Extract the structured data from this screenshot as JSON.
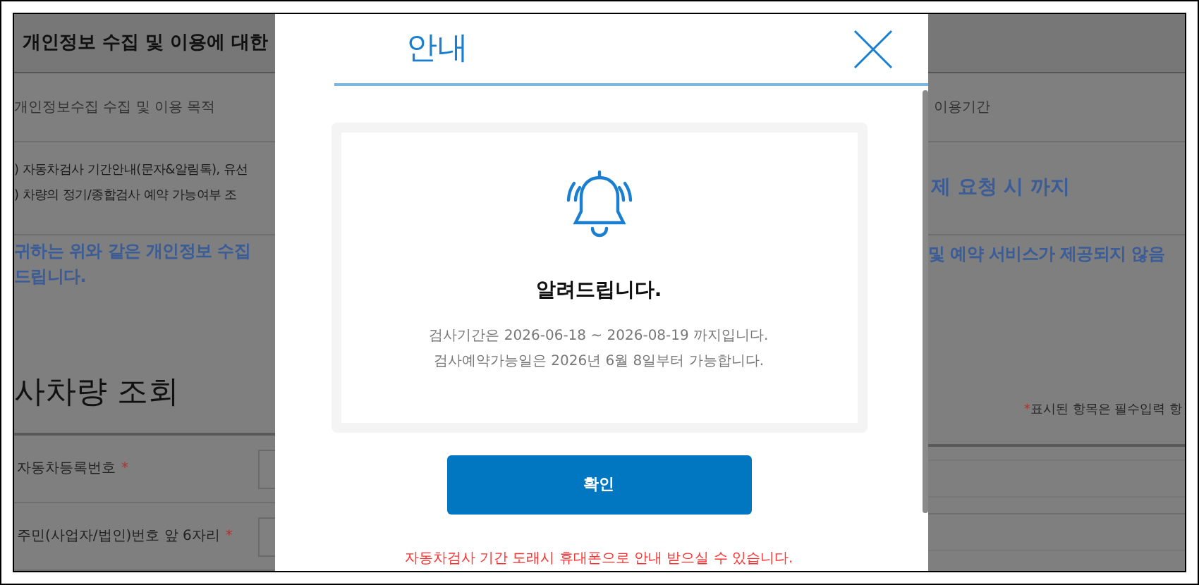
{
  "background_page": {
    "section_title": "개인정보 수집 및 이용에 대한",
    "purpose_header": "개인정보수집 수집 및 이용 목적",
    "purpose_items": [
      ") 자동차검사 기간안내(문자&알림톡), 유선",
      ") 차량의 정기/종합검사 예약 가능여부 조"
    ],
    "notice_lines": [
      "귀하는 위와 같은 개인정보 수집",
      "드립니다."
    ],
    "search_title": "사차량 조회",
    "required_mark": "*",
    "form_fields": [
      {
        "label": "자동차등록번호",
        "required": true
      },
      {
        "label": "주민(사업자/법인)번호 앞 6자리",
        "required": true
      }
    ],
    "period_header": "이용기간",
    "period_value": "제 요청 시 까지",
    "notice_right": "및 예약 서비스가 제공되지 않음",
    "required_note": "표시된 항목은 필수입력 항"
  },
  "dialog": {
    "title": "안내",
    "heading": "알려드립니다.",
    "message_lines": [
      "검사기간은 2026-06-18 ~ 2026-08-19 까지입니다.",
      "검사예약가능일은 2026년 6월 8일부터 가능합니다."
    ],
    "confirm_button": "확인",
    "footer_note": "자동차검사 기간 도래시 휴대폰으로 안내 받으실 수 있습니다."
  }
}
